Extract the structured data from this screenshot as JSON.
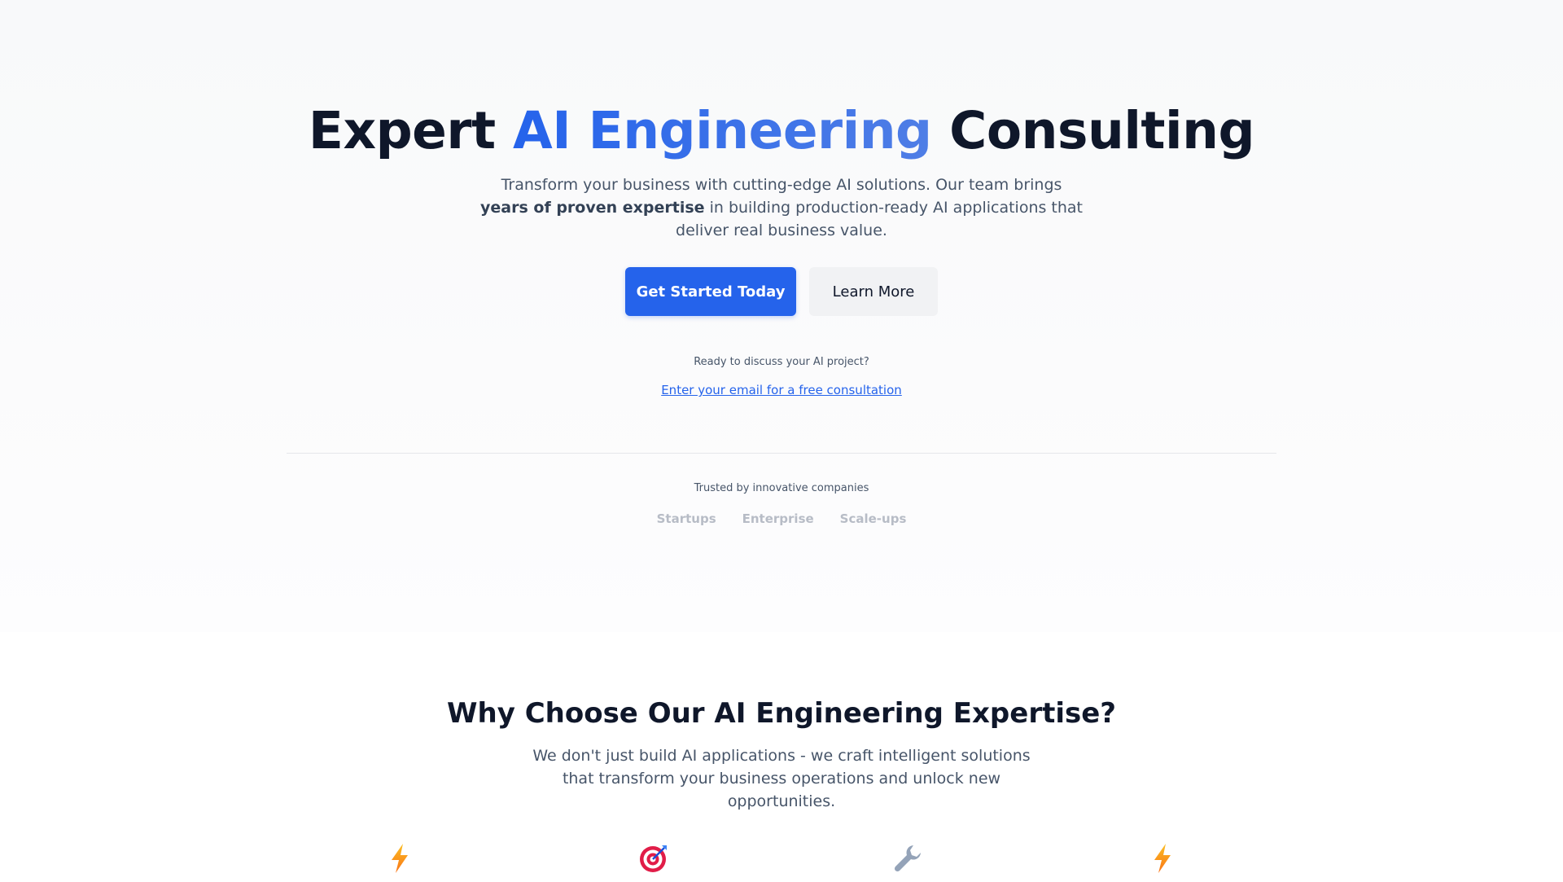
{
  "hero": {
    "title_before": "Expert ",
    "title_accent": "AI Engineering",
    "title_after": " Consulting",
    "subtitle_part1": "Transform your business with cutting-edge AI solutions. Our team brings ",
    "subtitle_bold": "years of proven expertise",
    "subtitle_part2": " in building production-ready AI applications that deliver real business value.",
    "primary_button": "Get Started Today",
    "secondary_button": "Learn More",
    "cta_question": "Ready to discuss your AI project?",
    "cta_link": "Enter your email for a free consultation",
    "trusted_label": "Trusted by innovative companies",
    "companies": [
      "Startups",
      "Enterprise",
      "Scale-ups"
    ]
  },
  "why": {
    "title": "Why Choose Our AI Engineering Expertise?",
    "subtitle": "We don't just build AI applications - we craft intelligent solutions that transform your business operations and unlock new opportunities.",
    "feature_icons": [
      "lightning-icon",
      "target-icon",
      "wrench-icon",
      "lightning-icon"
    ]
  },
  "colors": {
    "accent": "#2563eb",
    "heading": "#0f172a",
    "body_text": "#475569",
    "muted_company": "#b7bcc6"
  }
}
